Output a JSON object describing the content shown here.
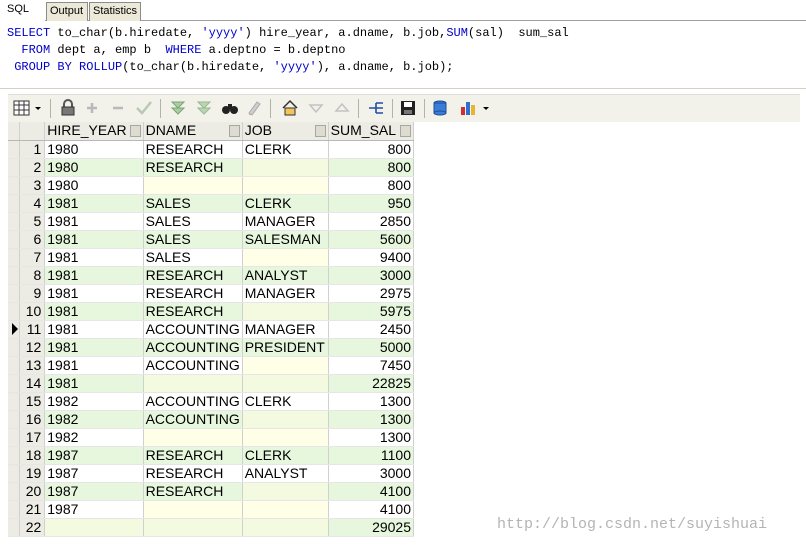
{
  "tabs": [
    {
      "label": "SQL",
      "active": true
    },
    {
      "label": "Output",
      "active": false
    },
    {
      "label": "Statistics",
      "active": false
    }
  ],
  "editor": {
    "lines": [
      [
        "SELECT",
        " to_char(b.hiredate, ",
        "'yyyy'",
        ") hire_year, a.dname, b.job,",
        "SUM",
        "(sal)  sum_sal"
      ],
      [
        "  FROM",
        " dept a, emp b  ",
        "WHERE",
        " a.deptno = b.deptno",
        "",
        ""
      ],
      [
        " GROUP BY",
        " ",
        "ROLLUP",
        "(to_char(b.hiredate, ",
        "'yyyy'",
        "), a.dname, b.job);"
      ]
    ]
  },
  "toolbar": {
    "icons": [
      "grid-layout-icon",
      "dropdown-arrow-icon",
      "lock-icon",
      "add-record-icon",
      "delete-record-icon",
      "post-changes-icon",
      "query-by-example-icon",
      "clear-filter-icon",
      "find-icon",
      "clear-record-icon",
      "home-icon",
      "next-page-icon",
      "previous-page-icon",
      "record-navigation-icon",
      "save-icon",
      "export-icon",
      "chart-icon",
      "chart-dropdown-icon"
    ]
  },
  "grid": {
    "columns": [
      "HIRE_YEAR",
      "DNAME",
      "JOB",
      "SUM_SAL"
    ],
    "current_row": 11,
    "rows": [
      [
        "1",
        "1980",
        "RESEARCH",
        "CLERK",
        "800"
      ],
      [
        "2",
        "1980",
        "RESEARCH",
        "",
        "800"
      ],
      [
        "3",
        "1980",
        "",
        "",
        "800"
      ],
      [
        "4",
        "1981",
        "SALES",
        "CLERK",
        "950"
      ],
      [
        "5",
        "1981",
        "SALES",
        "MANAGER",
        "2850"
      ],
      [
        "6",
        "1981",
        "SALES",
        "SALESMAN",
        "5600"
      ],
      [
        "7",
        "1981",
        "SALES",
        "",
        "9400"
      ],
      [
        "8",
        "1981",
        "RESEARCH",
        "ANALYST",
        "3000"
      ],
      [
        "9",
        "1981",
        "RESEARCH",
        "MANAGER",
        "2975"
      ],
      [
        "10",
        "1981",
        "RESEARCH",
        "",
        "5975"
      ],
      [
        "11",
        "1981",
        "ACCOUNTING",
        "MANAGER",
        "2450"
      ],
      [
        "12",
        "1981",
        "ACCOUNTING",
        "PRESIDENT",
        "5000"
      ],
      [
        "13",
        "1981",
        "ACCOUNTING",
        "",
        "7450"
      ],
      [
        "14",
        "1981",
        "",
        "",
        "22825"
      ],
      [
        "15",
        "1982",
        "ACCOUNTING",
        "CLERK",
        "1300"
      ],
      [
        "16",
        "1982",
        "ACCOUNTING",
        "",
        "1300"
      ],
      [
        "17",
        "1982",
        "",
        "",
        "1300"
      ],
      [
        "18",
        "1987",
        "RESEARCH",
        "CLERK",
        "1100"
      ],
      [
        "19",
        "1987",
        "RESEARCH",
        "ANALYST",
        "3000"
      ],
      [
        "20",
        "1987",
        "RESEARCH",
        "",
        "4100"
      ],
      [
        "21",
        "1987",
        "",
        "",
        "4100"
      ],
      [
        "22",
        "",
        "",
        "",
        "29025"
      ]
    ]
  },
  "watermark": "http://blog.csdn.net/suyishuai"
}
